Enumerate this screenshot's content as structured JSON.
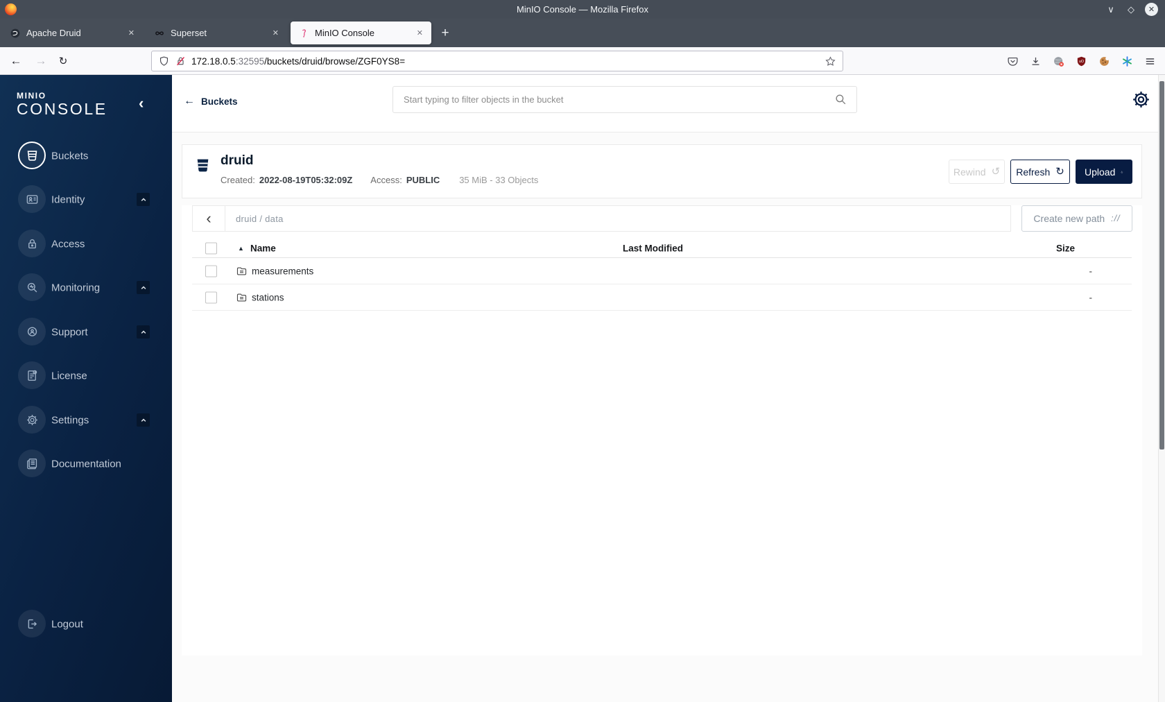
{
  "colors": {
    "accent_navy": "#081c42",
    "titlebar": "#474e58",
    "toolbar_bg": "#f9f9fb",
    "page_bg": "#fbfbfb",
    "ublock_red": "#7f1416",
    "flamingo_pink": "#e0427b"
  },
  "browser": {
    "window_title": "MinIO Console — Mozilla Firefox",
    "tabs": [
      {
        "title": "Apache Druid"
      },
      {
        "title": "Superset"
      },
      {
        "title": "MinIO Console"
      }
    ],
    "url_host": "172.18.0.5",
    "url_port": ":32595",
    "url_path": "/buckets/druid/browse/ZGF0YS8="
  },
  "glyphs": {
    "minimize": "∨",
    "maximize": "◇",
    "close": "✕",
    "tab_close": "✕",
    "new_tab": "+",
    "nav_back": "←",
    "nav_forward": "→",
    "reload": "↻",
    "back_arrow": "←",
    "collapse_chevron": "‹",
    "breadcrumb_back": "‹",
    "rewind_icon": "↺",
    "refresh_icon": "↻",
    "sort_asc": "▲",
    "create_path_icon": "://"
  },
  "sidebar": {
    "logo_line1": "MINIO",
    "logo_line2": "CONSOLE",
    "items": [
      {
        "label": "Buckets"
      },
      {
        "label": "Identity"
      },
      {
        "label": "Access"
      },
      {
        "label": "Monitoring"
      },
      {
        "label": "Support"
      },
      {
        "label": "License"
      },
      {
        "label": "Settings"
      },
      {
        "label": "Documentation"
      }
    ],
    "logout": "Logout"
  },
  "topbar": {
    "back_label": "Buckets",
    "search_placeholder": "Start typing to filter objects in the bucket"
  },
  "bucket": {
    "name": "druid",
    "created_label": "Created:",
    "created_value": "2022-08-19T05:32:09Z",
    "access_label": "Access:",
    "access_value": "PUBLIC",
    "usage": "35 MiB - 33 Objects",
    "rewind_label": "Rewind",
    "refresh_label": "Refresh",
    "upload_label": "Upload"
  },
  "browse": {
    "breadcrumb": "druid / data",
    "create_path_label": "Create new path"
  },
  "objects": {
    "columns": {
      "name": "Name",
      "last_modified": "Last Modified",
      "size": "Size"
    },
    "rows": [
      {
        "name": "measurements",
        "size": "-"
      },
      {
        "name": "stations",
        "size": "-"
      }
    ]
  }
}
